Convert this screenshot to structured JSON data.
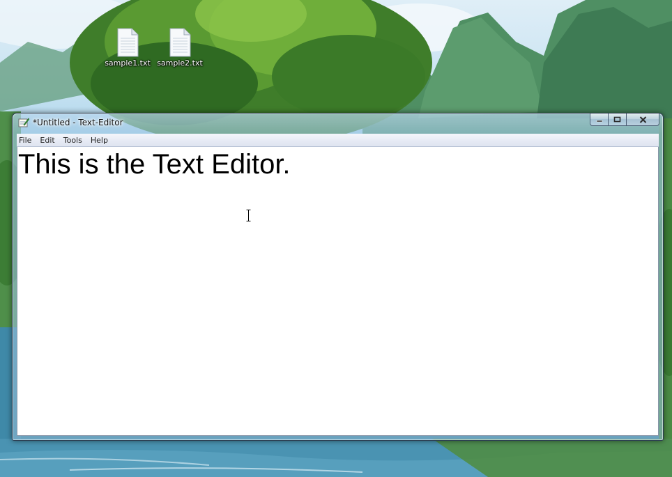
{
  "desktop": {
    "icons": [
      {
        "label": "sample1.txt",
        "icon": "text-file-icon"
      },
      {
        "label": "sample2.txt",
        "icon": "text-file-icon"
      }
    ]
  },
  "window": {
    "title": "*Untitled - Text-Editor",
    "app_icon": "notepad-icon",
    "caption_buttons": {
      "minimize_icon": "minimize-icon",
      "maximize_icon": "maximize-icon",
      "close_icon": "close-icon"
    },
    "menu": [
      {
        "label": "File"
      },
      {
        "label": "Edit"
      },
      {
        "label": "Tools"
      },
      {
        "label": "Help"
      }
    ],
    "editor": {
      "content": "This is the Text Editor."
    }
  },
  "colors": {
    "editor_background": "#ffffff",
    "menubar_background": "#e6eaf4",
    "window_frame": "#a8c8e4",
    "text": "#000000"
  }
}
